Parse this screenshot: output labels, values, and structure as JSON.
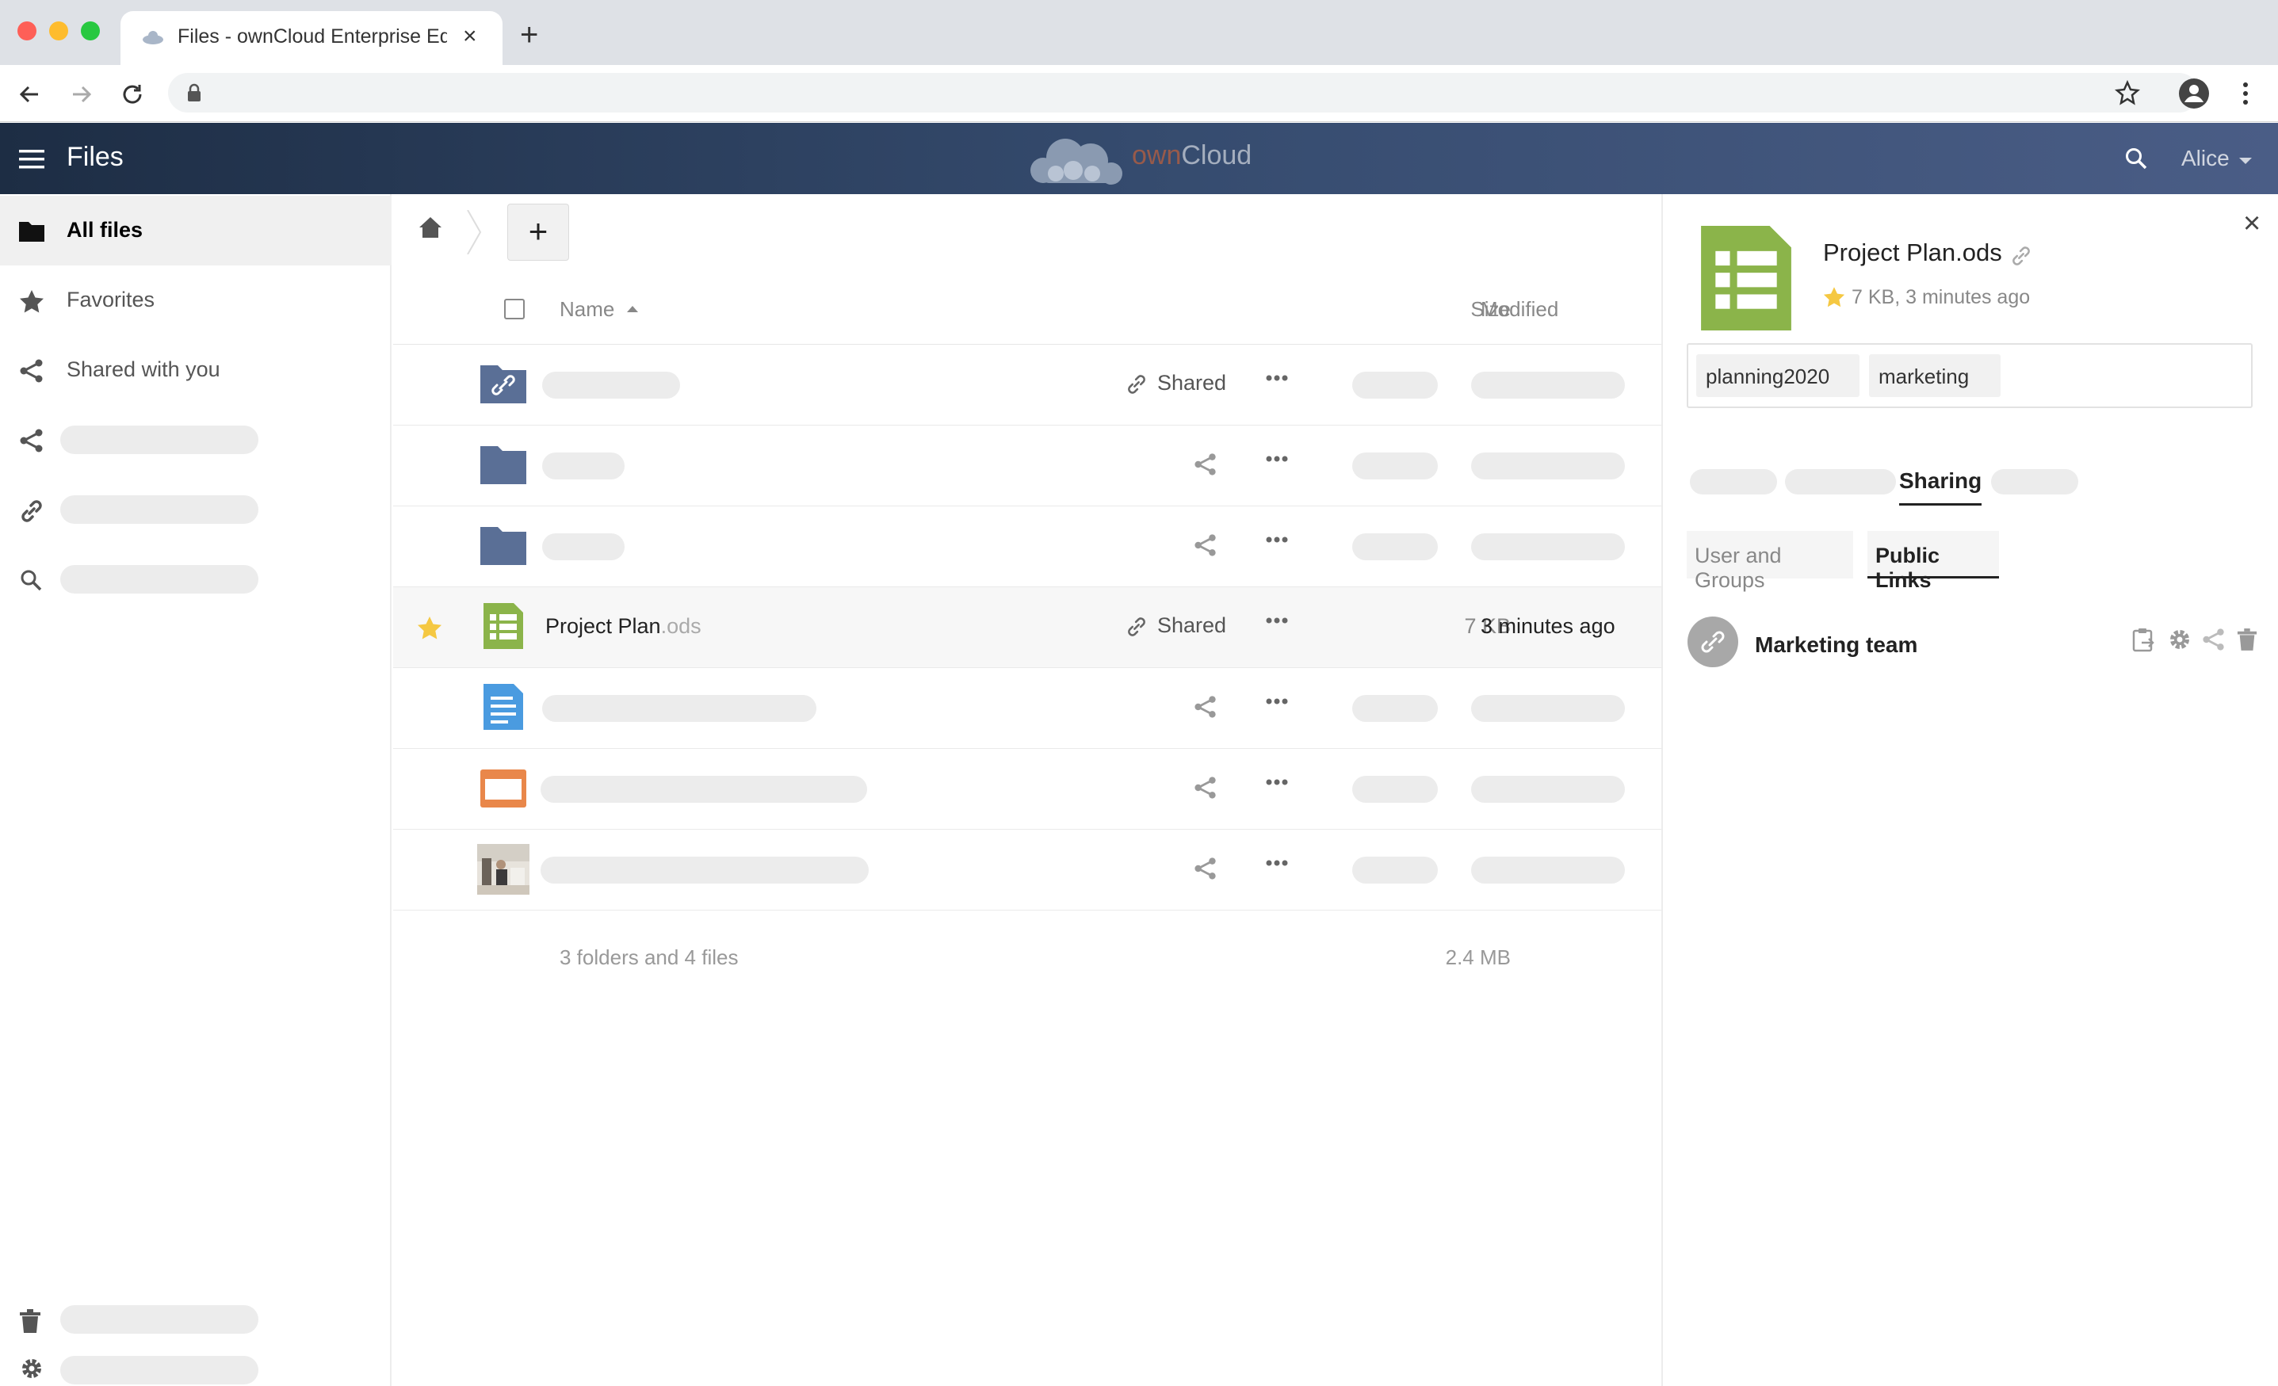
{
  "browser": {
    "tab_title": "Files - ownCloud Enterprise Edition",
    "new_tab": "+",
    "close_tab": "×"
  },
  "header": {
    "app_name": "Files",
    "brand_own": "own",
    "brand_cloud": "Cloud",
    "user": "Alice",
    "colors": {
      "header_start": "#1d2d44",
      "header_end": "#4a5d86",
      "brand_accent": "#e9672d"
    }
  },
  "sidebar": {
    "items": [
      {
        "label": "All files",
        "icon": "folder-icon",
        "active": true
      },
      {
        "label": "Favorites",
        "icon": "star-icon"
      },
      {
        "label": "Shared with you",
        "icon": "share-icon"
      },
      {
        "label": "",
        "icon": "share-icon"
      },
      {
        "label": "",
        "icon": "link-icon"
      },
      {
        "label": "",
        "icon": "search-icon"
      }
    ],
    "footer": [
      {
        "label": "",
        "icon": "trash-icon"
      },
      {
        "label": "",
        "icon": "gear-icon"
      }
    ]
  },
  "controls": {
    "new_button": "+"
  },
  "list": {
    "columns": {
      "name": "Name",
      "size": "Size",
      "modified": "Modified"
    },
    "rows": [
      {
        "type": "shared-folder",
        "name": "",
        "shared_label": "Shared",
        "size": "",
        "modified": ""
      },
      {
        "type": "folder",
        "name": "",
        "shared_label": "",
        "size": "",
        "modified": ""
      },
      {
        "type": "folder",
        "name": "",
        "shared_label": "",
        "size": "",
        "modified": ""
      },
      {
        "type": "spreadsheet",
        "name": "Project Plan",
        "ext": ".ods",
        "shared_label": "Shared",
        "size": "7 KB",
        "modified": "3 minutes ago",
        "favorite": true
      },
      {
        "type": "document",
        "name": "",
        "shared_label": "",
        "size": "",
        "modified": ""
      },
      {
        "type": "presentation",
        "name": "",
        "shared_label": "",
        "size": "",
        "modified": ""
      },
      {
        "type": "image",
        "name": "",
        "shared_label": "",
        "size": "",
        "modified": ""
      }
    ],
    "summary": {
      "text": "3 folders and 4 files",
      "size": "2.4 MB"
    }
  },
  "details": {
    "close": "×",
    "file_name": "Project Plan.ods",
    "meta": "7 KB, 3 minutes ago",
    "tags": [
      "planning2020",
      "marketing"
    ],
    "tabs": {
      "sharing": "Sharing"
    },
    "subtabs": {
      "users": "User and Groups",
      "public": "Public Links"
    },
    "link": {
      "name": "Marketing team"
    }
  }
}
